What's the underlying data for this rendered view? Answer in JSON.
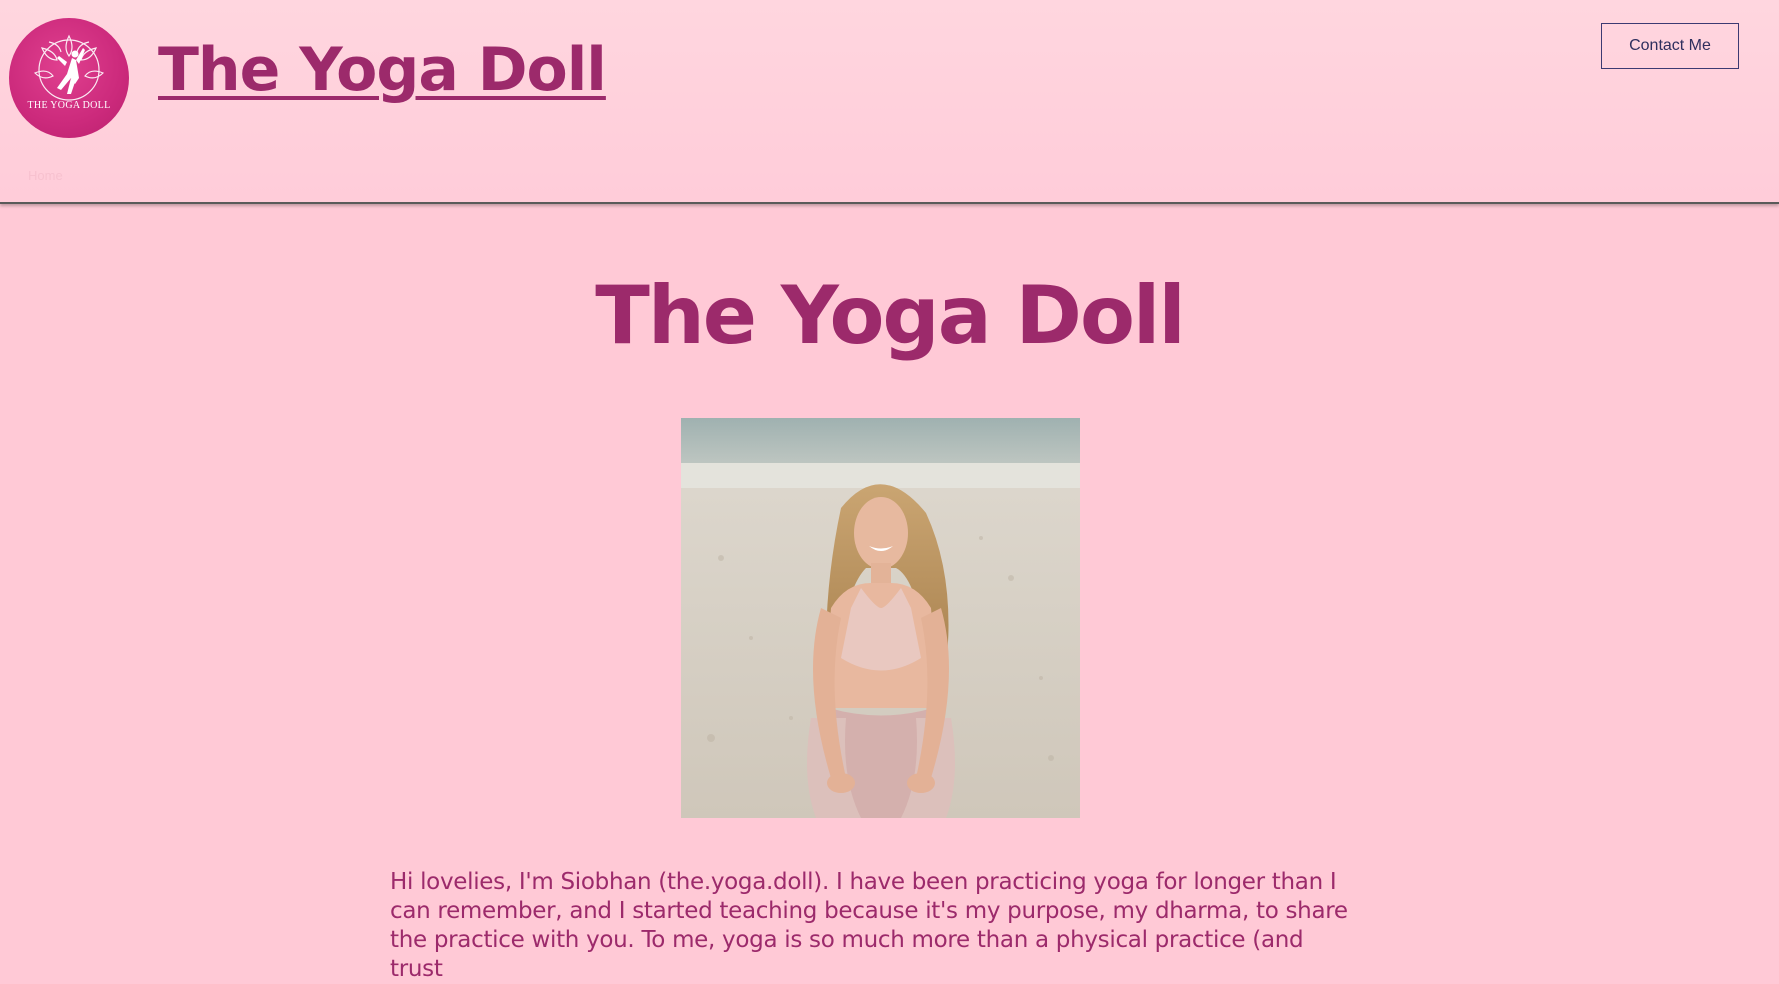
{
  "header": {
    "logo_text": "THE YOGA DOLL",
    "site_title": "The Yoga Doll",
    "contact_button": "Contact Me",
    "nav_faint": "Home"
  },
  "hero": {
    "title": "The Yoga Doll",
    "intro": "Hi lovelies, I'm Siobhan (the.yoga.doll). I have been practicing yoga for longer than I can remember, and I started teaching because it's my purpose, my dharma, to share the practice with you. To me, yoga is so much more than a physical practice (and trust"
  },
  "colors": {
    "background": "#ffc9d6",
    "accent": "#9c2a6b",
    "logo": "#cc2a7c",
    "button_border": "#3c3a72"
  },
  "icons": {
    "logo": "yoga-pose-mandala-icon"
  }
}
